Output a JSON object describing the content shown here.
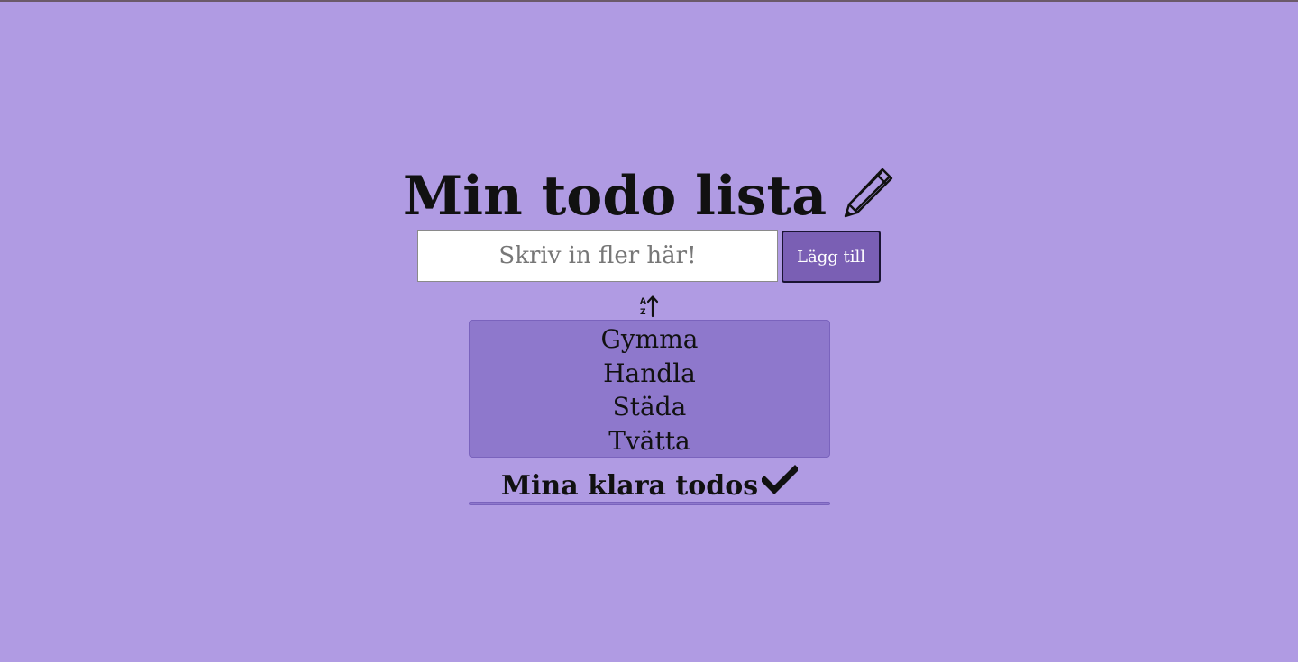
{
  "header": {
    "title": "Min todo lista",
    "title_icon": "pencil-icon"
  },
  "add_form": {
    "placeholder": "Skriv in fler här!",
    "value": "",
    "button_label": "Lägg till"
  },
  "sort": {
    "icon": "sort-alpha-ascending-icon",
    "glyph_top": "A",
    "glyph_bottom": "Z"
  },
  "todos": {
    "items": [
      {
        "label": "Gymma"
      },
      {
        "label": "Handla"
      },
      {
        "label": "Städa"
      },
      {
        "label": "Tvätta"
      }
    ]
  },
  "done": {
    "title": "Mina klara todos",
    "title_icon": "checkmark-icon",
    "items": []
  },
  "colors": {
    "background": "#b09be3",
    "list_background": "#8e78cc",
    "button_background": "#7a5fb4",
    "text": "#111111"
  }
}
